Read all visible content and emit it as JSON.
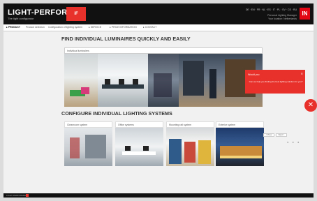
{
  "header": {
    "brand": "LIGHT-PERFORMER",
    "tagline": "The light configurator",
    "if_logo": "iF",
    "languages": "DE · EN · FR · NL · ES · IT · PL · SV · CS · RU",
    "account_line1": "Personal Lighting Manager",
    "account_line2": "Your location: Netherlands",
    "in_logo": "IN"
  },
  "nav": {
    "items": [
      {
        "label": "▸ PRODUCT"
      },
      {
        "label": "Product selection"
      },
      {
        "label": "Configuration of lighting system"
      },
      {
        "label": "▸ SERVICE"
      },
      {
        "label": "▸ PRICE INFORMATION"
      },
      {
        "label": "▸ CONTACT"
      }
    ]
  },
  "main": {
    "heading1": "FIND INDIVIDUAL LUMINAIRES QUICKLY AND EASILY",
    "search_placeholder": "Individual luminaires",
    "heading2": "CONFIGURE INDIVIDUAL LIGHTING SYSTEMS",
    "cards": [
      {
        "label": "Cleanroom system"
      },
      {
        "label": "Office systems"
      },
      {
        "label": "Mounting rail system"
      },
      {
        "label": "Exterior system"
      }
    ],
    "pager": [
      "< Prev",
      "Next >"
    ],
    "dots": "● ● ●"
  },
  "popup": {
    "title": "Would you",
    "close": "✕",
    "body": "Can we help you finding the best lighting solution for you?"
  },
  "fab": "✕",
  "footer": {
    "text": "LIGHT-PERFORMER"
  },
  "colors": {
    "accent": "#e8312a",
    "header_bg": "#111111",
    "page_bg": "#f1f1f1"
  }
}
